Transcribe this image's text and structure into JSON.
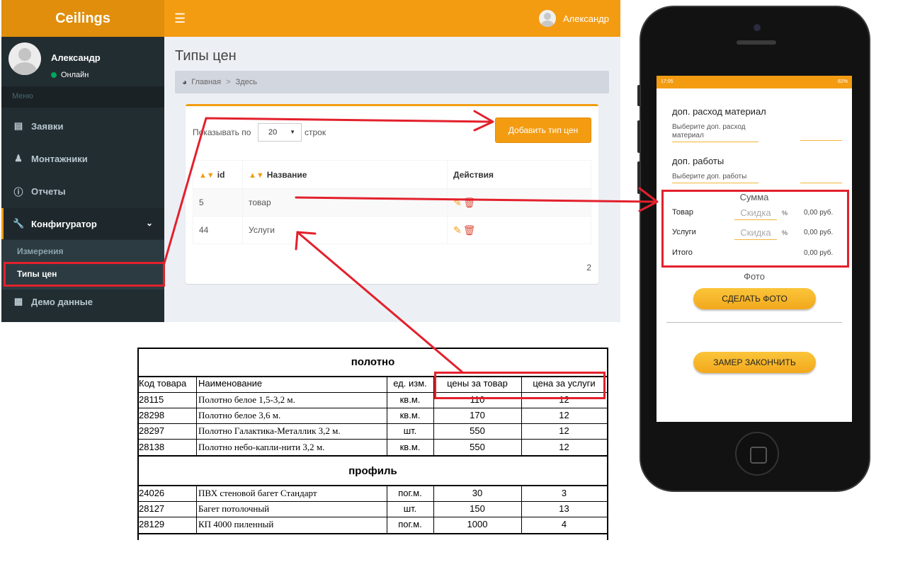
{
  "admin": {
    "brand": "Ceilings",
    "top_user_name": "Александр",
    "sidebar": {
      "user_name": "Александр",
      "user_status": "Онлайн",
      "menu_header": "Меню",
      "items": [
        {
          "label": "Заявки",
          "icon": "clipboard-icon"
        },
        {
          "label": "Монтажники",
          "icon": "person-icon"
        },
        {
          "label": "Отчеты",
          "icon": "info-icon"
        },
        {
          "label": "Конфигуратор",
          "icon": "wrench-icon"
        },
        {
          "label": "Демо данные",
          "icon": "id-card-icon"
        }
      ],
      "subitems": [
        {
          "label": "Измерения"
        },
        {
          "label": "Типы цен"
        }
      ]
    },
    "page_title": "Типы цен",
    "breadcrumb": {
      "home": "Главная",
      "separator": ">",
      "current": "Здесь"
    },
    "box": {
      "show_label": "Показывать по",
      "page_size": "20",
      "rows_label": "строк",
      "add_button": "Добавить тип цен",
      "columns": [
        "id",
        "Название",
        "Действия"
      ],
      "rows": [
        {
          "id": "5",
          "name": "товар"
        },
        {
          "id": "44",
          "name": "Услуги"
        }
      ],
      "pager": "2"
    }
  },
  "sheet": {
    "sections": [
      {
        "title": "полотно",
        "headers": [
          "Код товара",
          "Наименование",
          "ед. изм.",
          "цены за товар",
          "цена за услуги"
        ],
        "rows": [
          [
            "28115",
            "Полотно белое 1,5-3,2 м.",
            "кв.м.",
            "110",
            "12"
          ],
          [
            "28298",
            "Полотно белое 3,6 м.",
            "кв.м.",
            "170",
            "12"
          ],
          [
            "28297",
            "Полотно Галактика-Металлик 3,2 м.",
            "шт.",
            "550",
            "12"
          ],
          [
            "28138",
            "Полотно небо-капли-нити 3,2 м.",
            "кв.м.",
            "550",
            "12"
          ]
        ]
      },
      {
        "title": "профиль",
        "rows": [
          [
            "24026",
            "ПВХ стеновой багет Стандарт",
            "пог.м.",
            "30",
            "3"
          ],
          [
            "28127",
            "Багет потолочный",
            "шт.",
            "150",
            "13"
          ],
          [
            "28129",
            "КП 4000 пиленный",
            "пог.м.",
            "1000",
            "4"
          ]
        ]
      }
    ]
  },
  "phone": {
    "status_time": "17:05",
    "status_battery": "82%",
    "extra_material_label": "доп. расход материал",
    "extra_material_hint": "Выберите доп. расход материал",
    "extra_work_label": "доп. работы",
    "extra_work_hint": "Выберите доп. работы",
    "sum_title": "Сумма",
    "sum_rows": [
      {
        "label": "Товар",
        "discount_placeholder": "Скидка",
        "pct": "%",
        "amount": "0,00 руб."
      },
      {
        "label": "Услуги",
        "discount_placeholder": "Скидка",
        "pct": "%",
        "amount": "0,00 руб."
      }
    ],
    "total_label": "Итого",
    "total_amount": "0,00 руб.",
    "photo_label": "Фото",
    "photo_button": "СДЕЛАТЬ ФОТО",
    "finish_button": "ЗАМЕР ЗАКОНЧИТЬ"
  },
  "colors": {
    "accent": "#f39c12",
    "sidebar": "#222d32",
    "annotation": "#e3202c"
  }
}
